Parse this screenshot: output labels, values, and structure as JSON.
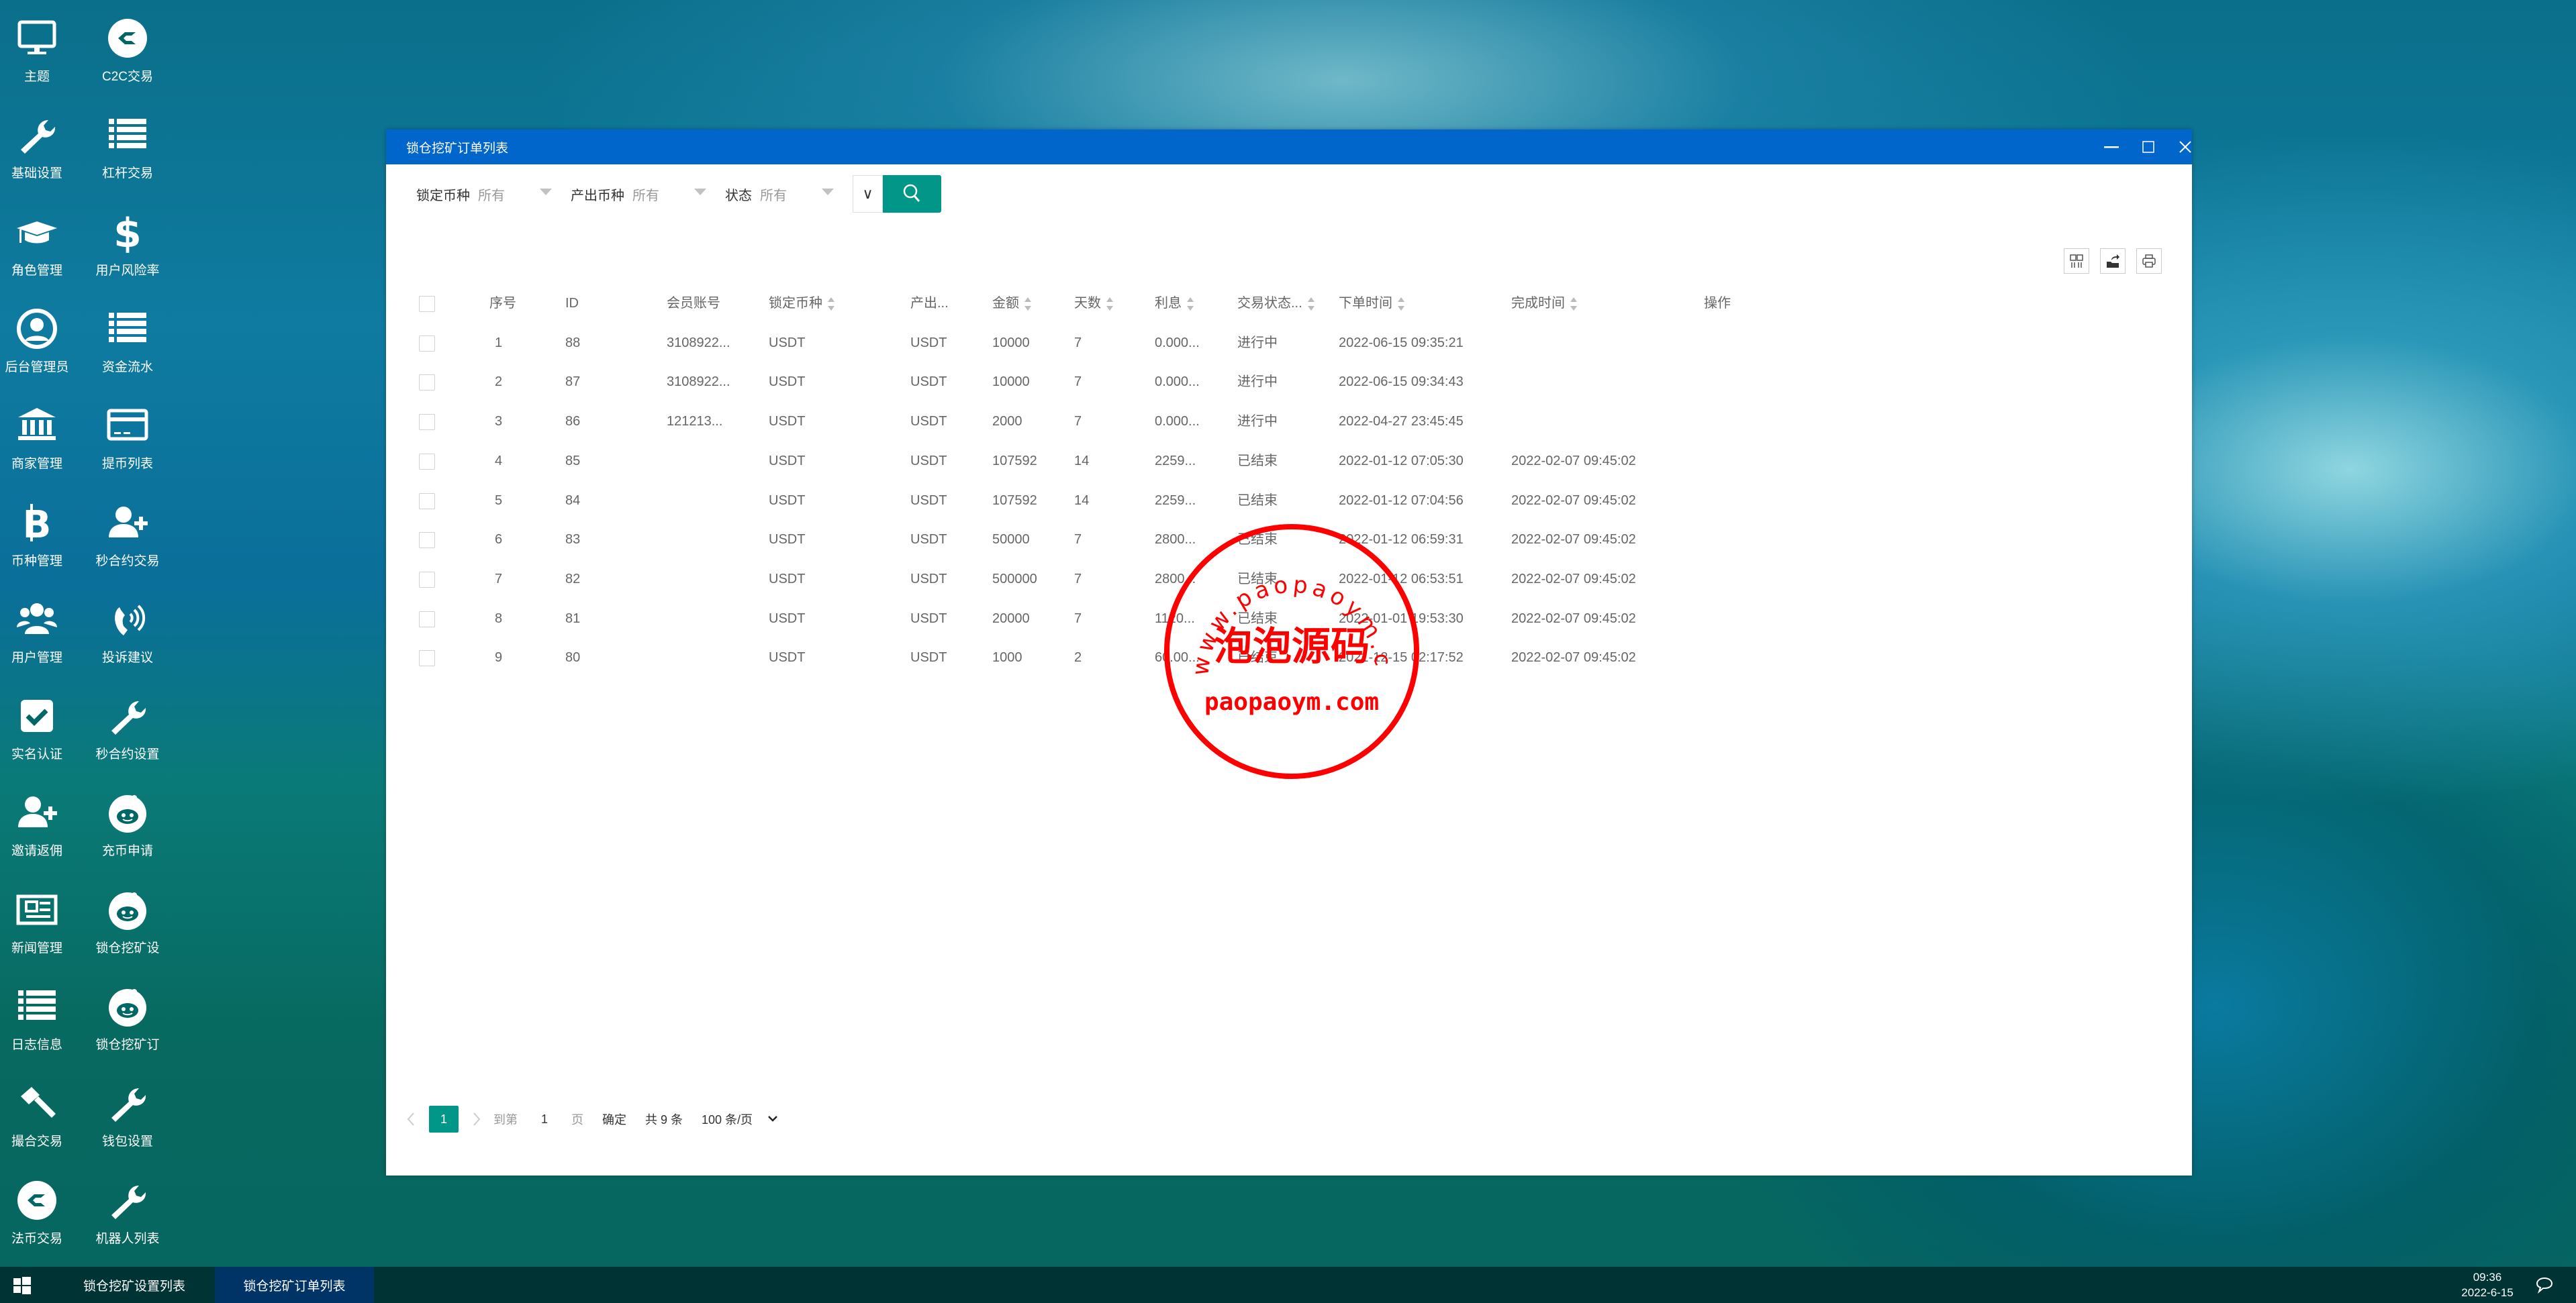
{
  "desktop": {
    "icons": [
      {
        "label": "主题",
        "icon": "monitor-icon"
      },
      {
        "label": "C2C交易",
        "icon": "exchange-logo-icon"
      },
      {
        "label": "基础设置",
        "icon": "wrench-icon"
      },
      {
        "label": "杠杆交易",
        "icon": "list-icon"
      },
      {
        "label": "角色管理",
        "icon": "graduation-cap-icon"
      },
      {
        "label": "用户风险率",
        "icon": "dollar-icon"
      },
      {
        "label": "后台管理员",
        "icon": "user-circle-icon"
      },
      {
        "label": "资金流水",
        "icon": "list-icon"
      },
      {
        "label": "商家管理",
        "icon": "bank-icon"
      },
      {
        "label": "提币列表",
        "icon": "credit-card-icon"
      },
      {
        "label": "币种管理",
        "icon": "bitcoin-icon"
      },
      {
        "label": "秒合约交易",
        "icon": "user-plus-icon"
      },
      {
        "label": "用户管理",
        "icon": "users-icon"
      },
      {
        "label": "投诉建议",
        "icon": "phone-volume-icon"
      },
      {
        "label": "实名认证",
        "icon": "check-square-icon"
      },
      {
        "label": "秒合约设置",
        "icon": "wrench-icon"
      },
      {
        "label": "邀请返佣",
        "icon": "user-plus-icon"
      },
      {
        "label": "充币申请",
        "icon": "reddit-icon"
      },
      {
        "label": "新闻管理",
        "icon": "newspaper-icon"
      },
      {
        "label": "锁仓挖矿设",
        "icon": "reddit-icon"
      },
      {
        "label": "日志信息",
        "icon": "list-icon"
      },
      {
        "label": "锁仓挖矿订",
        "icon": "reddit-icon"
      },
      {
        "label": "撮合交易",
        "icon": "gavel-icon"
      },
      {
        "label": "钱包设置",
        "icon": "wrench-icon"
      },
      {
        "label": "法币交易",
        "icon": "exchange-logo-icon"
      },
      {
        "label": "机器人列表",
        "icon": "wrench-icon"
      }
    ]
  },
  "window": {
    "title": "锁仓挖矿订单列表",
    "filters": [
      {
        "label": "锁定币种",
        "value": "所有"
      },
      {
        "label": "产出币种",
        "value": "所有"
      },
      {
        "label": "状态",
        "value": "所有"
      }
    ],
    "expand_label": "∨",
    "accent": "#009688",
    "titlebar_color": "#0066cc",
    "toolbar": [
      "columns-icon",
      "export-icon",
      "print-icon"
    ],
    "columns": [
      {
        "label": "序号",
        "sortable": false
      },
      {
        "label": "ID",
        "sortable": false
      },
      {
        "label": "会员账号",
        "sortable": false
      },
      {
        "label": "锁定币种",
        "sortable": true
      },
      {
        "label": "产出...",
        "sortable": false
      },
      {
        "label": "金额",
        "sortable": true
      },
      {
        "label": "天数",
        "sortable": true
      },
      {
        "label": "利息",
        "sortable": true
      },
      {
        "label": "交易状态...",
        "sortable": true
      },
      {
        "label": "下单时间",
        "sortable": true
      },
      {
        "label": "完成时间",
        "sortable": true
      },
      {
        "label": "操作",
        "sortable": false
      }
    ],
    "rows": [
      [
        "1",
        "88",
        "3108922...",
        "USDT",
        "USDT",
        "10000",
        "7",
        "0.000...",
        "进行中",
        "2022-06-15 09:35:21",
        "",
        ""
      ],
      [
        "2",
        "87",
        "3108922...",
        "USDT",
        "USDT",
        "10000",
        "7",
        "0.000...",
        "进行中",
        "2022-06-15 09:34:43",
        "",
        ""
      ],
      [
        "3",
        "86",
        "121213...",
        "USDT",
        "USDT",
        "2000",
        "7",
        "0.000...",
        "进行中",
        "2022-04-27 23:45:45",
        "",
        ""
      ],
      [
        "4",
        "85",
        "",
        "USDT",
        "USDT",
        "107592",
        "14",
        "2259...",
        "已结束",
        "2022-01-12 07:05:30",
        "2022-02-07 09:45:02",
        ""
      ],
      [
        "5",
        "84",
        "",
        "USDT",
        "USDT",
        "107592",
        "14",
        "2259...",
        "已结束",
        "2022-01-12 07:04:56",
        "2022-02-07 09:45:02",
        ""
      ],
      [
        "6",
        "83",
        "",
        "USDT",
        "USDT",
        "50000",
        "7",
        "2800...",
        "已结束",
        "2022-01-12 06:59:31",
        "2022-02-07 09:45:02",
        ""
      ],
      [
        "7",
        "82",
        "",
        "USDT",
        "USDT",
        "500000",
        "7",
        "2800...",
        "已结束",
        "2022-01-12 06:53:51",
        "2022-02-07 09:45:02",
        ""
      ],
      [
        "8",
        "81",
        "",
        "USDT",
        "USDT",
        "20000",
        "7",
        "1120...",
        "已结束",
        "2022-01-01 19:53:30",
        "2022-02-07 09:45:02",
        ""
      ],
      [
        "9",
        "80",
        "",
        "USDT",
        "USDT",
        "1000",
        "2",
        "60.00...",
        "已结束",
        "2021-12-15 02:17:52",
        "2022-02-07 09:45:02",
        ""
      ]
    ],
    "pagination": {
      "current": "1",
      "goto_prefix": "到第",
      "goto_value": "1",
      "goto_suffix": "页",
      "confirm": "确定",
      "total": "共 9 条",
      "page_size": "100 条/页"
    }
  },
  "watermark": {
    "arc": "www.paopaoym.com",
    "center": "泡泡源码",
    "bottom": "paopaoym.com",
    "color": "#ff0000"
  },
  "taskbar": {
    "tabs": [
      {
        "label": "锁仓挖矿设置列表",
        "active": false
      },
      {
        "label": "锁仓挖矿订单列表",
        "active": true
      }
    ],
    "time": "09:36",
    "date": "2022-6-15"
  }
}
